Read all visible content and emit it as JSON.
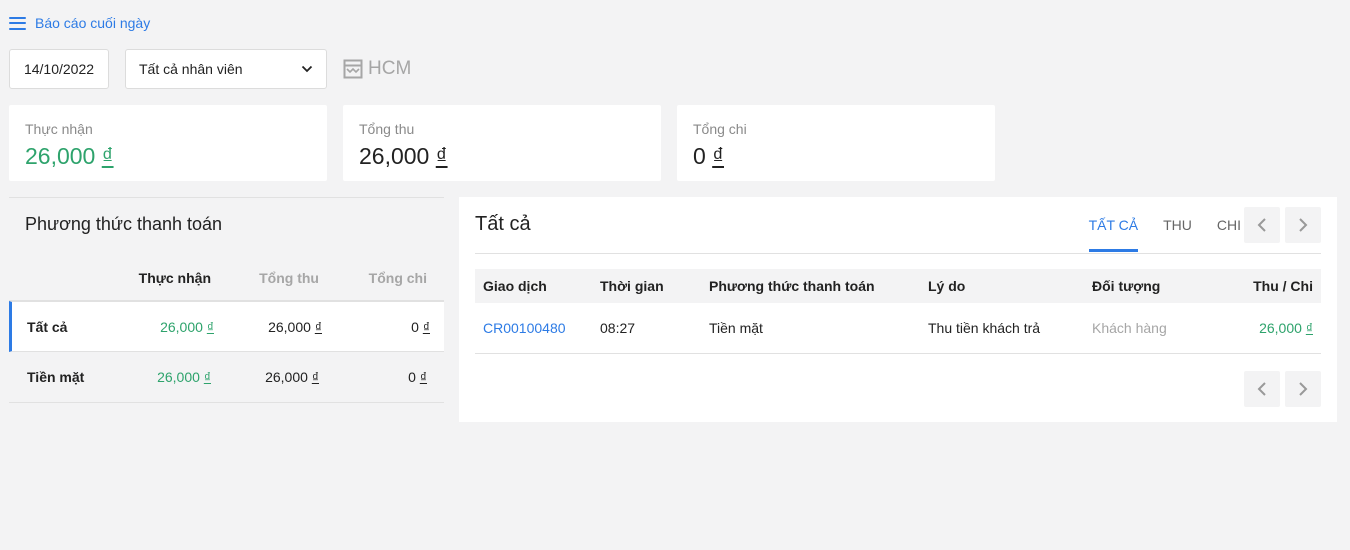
{
  "header": {
    "title": "Báo cáo cuối ngày"
  },
  "filters": {
    "date": "14/10/2022",
    "staff": "Tất cả nhân viên",
    "store": "HCM"
  },
  "summary": [
    {
      "label": "Thực nhận",
      "value": "26,000",
      "currency": "₫"
    },
    {
      "label": "Tổng thu",
      "value": "26,000",
      "currency": "₫"
    },
    {
      "label": "Tổng chi",
      "value": "0",
      "currency": "₫"
    }
  ],
  "payment_methods": {
    "title": "Phương thức thanh toán",
    "columns": [
      "Thực nhận",
      "Tổng thu",
      "Tổng chi"
    ],
    "rows": [
      {
        "name": "Tất cả",
        "received": "26,000",
        "income": "26,000",
        "expense": "0"
      },
      {
        "name": "Tiền mặt",
        "received": "26,000",
        "income": "26,000",
        "expense": "0"
      }
    ],
    "currency": "₫"
  },
  "transactions": {
    "title": "Tất cả",
    "tabs": [
      "TẤT CẢ",
      "THU",
      "CHI"
    ],
    "active_tab": "TẤT CẢ",
    "columns": [
      "Giao dịch",
      "Thời gian",
      "Phương thức thanh toán",
      "Lý do",
      "Đối tượng",
      "Thu / Chi"
    ],
    "rows": [
      {
        "code": "CR00100480",
        "time": "08:27",
        "method": "Tiền mặt",
        "reason": "Thu tiền khách trả",
        "party": "Khách hàng",
        "amount": "26,000"
      }
    ],
    "currency": "₫"
  },
  "colors": {
    "accent": "#2d7be5",
    "positive": "#2ea36c",
    "background": "#f3f3f4"
  }
}
